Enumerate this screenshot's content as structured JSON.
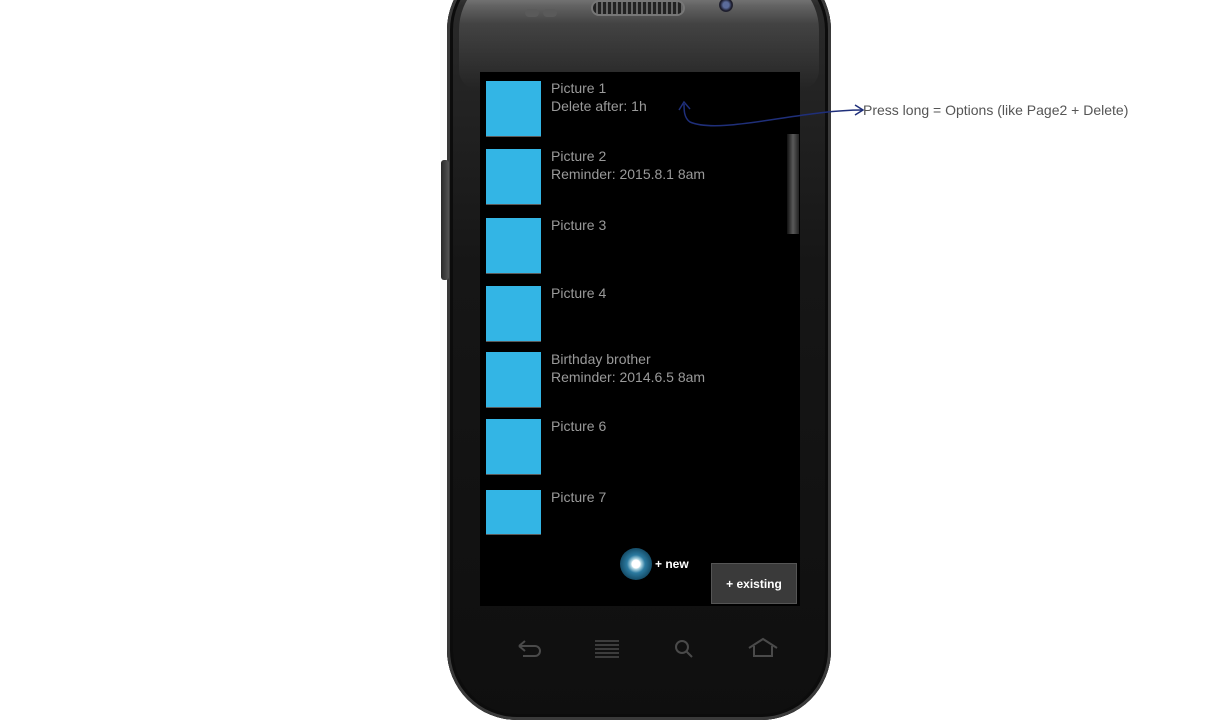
{
  "list": {
    "items": [
      {
        "title": "Picture 1",
        "subtitle": "Delete after: 1h"
      },
      {
        "title": "Picture 2",
        "subtitle": "Reminder: 2015.8.1 8am"
      },
      {
        "title": "Picture 3",
        "subtitle": ""
      },
      {
        "title": "Picture 4",
        "subtitle": ""
      },
      {
        "title": "Birthday brother",
        "subtitle": "Reminder: 2014.6.5 8am"
      },
      {
        "title": "Picture 6",
        "subtitle": ""
      },
      {
        "title": "Picture 7",
        "subtitle": ""
      }
    ]
  },
  "actions": {
    "new_label": "+ new",
    "existing_label": "+ existing"
  },
  "annotation": {
    "text": "Press long = Options (like Page2 + Delete)"
  },
  "nav_icons": [
    "back-icon",
    "menu-icon",
    "search-icon",
    "home-icon"
  ],
  "colors": {
    "thumbnail": "#33b5e5",
    "screen_bg": "#000000",
    "list_text": "#9a9a9a",
    "annotation_arrow": "#1f2f7a"
  }
}
